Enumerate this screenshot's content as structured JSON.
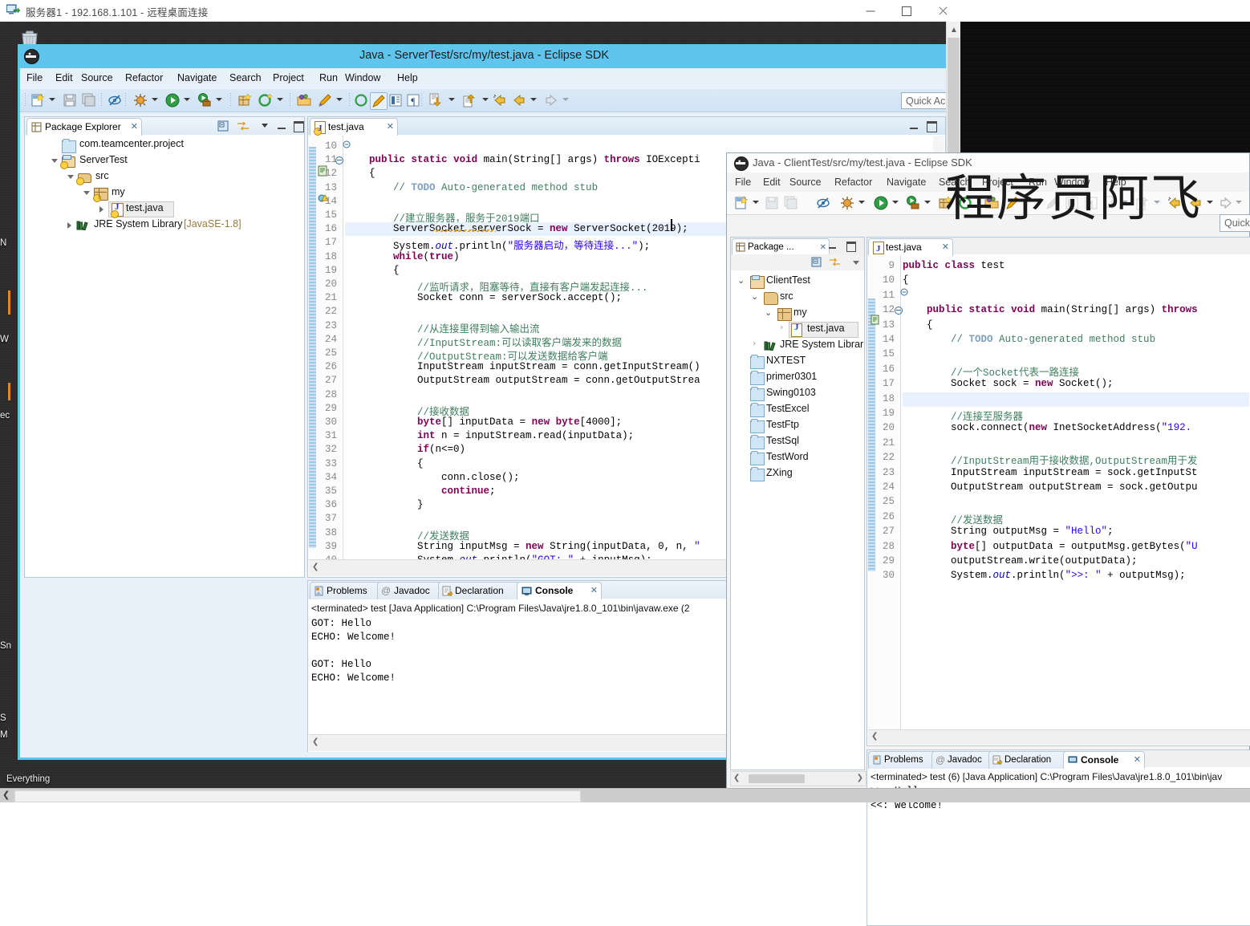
{
  "rdp": {
    "title": "服务器1 - 192.168.1.101 - 远程桌面连接",
    "icon": "remote-desktop-icon",
    "minimize": "—",
    "maximize": "□",
    "close": "✕"
  },
  "desktop": {
    "recycle_bin": "recycle-bin-icon",
    "everything_label": "Everything",
    "partial_icons": [
      "N",
      "W",
      "ec",
      "Sn",
      "S",
      "M"
    ]
  },
  "watermark": "程序员阿飞",
  "window1": {
    "title": "Java - ServerTest/src/my/test.java - Eclipse SDK",
    "menu": [
      "File",
      "Edit",
      "Source",
      "Refactor",
      "Navigate",
      "Search",
      "Project",
      "Run",
      "Window",
      "Help"
    ],
    "quick_access": "Quick Acc",
    "explorer": {
      "tab": "Package Explorer",
      "close_glyph": "✕",
      "tree": [
        {
          "label": "com.teamcenter.project",
          "icon": "folder-blue-icon",
          "indent": 0,
          "arrow": "none"
        },
        {
          "label": "ServerTest",
          "icon": "java-project-icon",
          "indent": 0,
          "arrow": "down"
        },
        {
          "label": "src",
          "icon": "source-folder-icon",
          "indent": 1,
          "arrow": "down"
        },
        {
          "label": "my",
          "icon": "package-icon",
          "indent": 2,
          "arrow": "down"
        },
        {
          "label": "test.java",
          "icon": "java-file-icon",
          "indent": 3,
          "arrow": "right",
          "selected": true
        },
        {
          "label": "JRE System Library",
          "suffix": "[JavaSE-1.8]",
          "icon": "jre-library-icon",
          "indent": 1,
          "arrow": "right"
        }
      ]
    },
    "editor": {
      "tab": "test.java",
      "close_glyph": "✕",
      "first_line": 10,
      "lines": [
        {
          "n": 10,
          "text": ""
        },
        {
          "n": 11,
          "text": "    public static void main(String[] args) throws IOExcepti",
          "fold": true
        },
        {
          "n": 12,
          "text": "    {"
        },
        {
          "n": 13,
          "text": "        // TODO Auto-generated method stub"
        },
        {
          "n": 14,
          "text": ""
        },
        {
          "n": 15,
          "text": "        //建立服务器，服务于2019端口"
        },
        {
          "n": 16,
          "text": "        ServerSocket serverSock = new ServerSocket(2019);",
          "highlight": true
        },
        {
          "n": 17,
          "text": "        System.out.println(\"服务器启动，等待连接...\");"
        },
        {
          "n": 18,
          "text": "        while(true)"
        },
        {
          "n": 19,
          "text": "        {"
        },
        {
          "n": 20,
          "text": "            //监听请求，阻塞等待，直接有客户端发起连接..."
        },
        {
          "n": 21,
          "text": "            Socket conn = serverSock.accept();"
        },
        {
          "n": 22,
          "text": ""
        },
        {
          "n": 23,
          "text": "            //从连接里得到输入输出流"
        },
        {
          "n": 24,
          "text": "            //InputStream:可以读取客户端发来的数据"
        },
        {
          "n": 25,
          "text": "            //OutputStream:可以发送数据给客户端"
        },
        {
          "n": 26,
          "text": "            InputStream inputStream = conn.getInputStream()"
        },
        {
          "n": 27,
          "text": "            OutputStream outputStream = conn.getOutputStrea"
        },
        {
          "n": 28,
          "text": ""
        },
        {
          "n": 29,
          "text": "            //接收数据"
        },
        {
          "n": 30,
          "text": "            byte[] inputData = new byte[4000];"
        },
        {
          "n": 31,
          "text": "            int n = inputStream.read(inputData);"
        },
        {
          "n": 32,
          "text": "            if(n<=0)"
        },
        {
          "n": 33,
          "text": "            {"
        },
        {
          "n": 34,
          "text": "                conn.close();"
        },
        {
          "n": 35,
          "text": "                continue;"
        },
        {
          "n": 36,
          "text": "            }"
        },
        {
          "n": 37,
          "text": ""
        },
        {
          "n": 38,
          "text": "            //发送数据"
        },
        {
          "n": 39,
          "text": "            String inputMsg = new String(inputData, 0, n, \""
        },
        {
          "n": 40,
          "text": "            System.out.println(\"GOT: \" + inputMsg);"
        }
      ]
    },
    "bottom_panel": {
      "tabs": [
        "Problems",
        "Javadoc",
        "Declaration",
        "Console"
      ],
      "active_tab": "Console",
      "close_glyph": "✕",
      "launch_line": "<terminated> test [Java Application] C:\\Program Files\\Java\\jre1.8.0_101\\bin\\javaw.exe (2",
      "output": [
        "GOT: Hello",
        "ECHO: Welcome!",
        "",
        "GOT: Hello",
        "ECHO: Welcome!"
      ]
    }
  },
  "window2": {
    "title": "Java - ClientTest/src/my/test.java - Eclipse SDK",
    "menu": [
      "File",
      "Edit",
      "Source",
      "Refactor",
      "Navigate",
      "Search",
      "Project",
      "Run",
      "Window",
      "Help"
    ],
    "quick_access": "Quick",
    "explorer": {
      "tab": "Package ...",
      "close_glyph": "✕",
      "tree": [
        {
          "label": "ClientTest",
          "icon": "java-project-icon",
          "indent": 0,
          "arrow": "down"
        },
        {
          "label": "src",
          "icon": "source-folder-icon",
          "indent": 1,
          "arrow": "down"
        },
        {
          "label": "my",
          "icon": "package-icon",
          "indent": 2,
          "arrow": "down"
        },
        {
          "label": "test.java",
          "icon": "java-file-icon",
          "indent": 3,
          "arrow": "right",
          "selected": true
        },
        {
          "label": "JRE System Librar",
          "icon": "jre-library-icon",
          "indent": 1,
          "arrow": "right"
        },
        {
          "label": "NXTEST",
          "icon": "folder-blue-icon",
          "indent": 0,
          "arrow": "none"
        },
        {
          "label": "primer0301",
          "icon": "folder-blue-icon",
          "indent": 0,
          "arrow": "none"
        },
        {
          "label": "Swing0103",
          "icon": "folder-blue-icon",
          "indent": 0,
          "arrow": "none"
        },
        {
          "label": "TestExcel",
          "icon": "folder-blue-icon",
          "indent": 0,
          "arrow": "none"
        },
        {
          "label": "TestFtp",
          "icon": "folder-blue-icon",
          "indent": 0,
          "arrow": "none"
        },
        {
          "label": "TestSql",
          "icon": "folder-blue-icon",
          "indent": 0,
          "arrow": "none"
        },
        {
          "label": "TestWord",
          "icon": "folder-blue-icon",
          "indent": 0,
          "arrow": "none"
        },
        {
          "label": "ZXing",
          "icon": "folder-blue-icon",
          "indent": 0,
          "arrow": "none"
        }
      ]
    },
    "editor": {
      "tab": "test.java",
      "close_glyph": "✕",
      "lines": [
        {
          "n": 9,
          "text": "public class test"
        },
        {
          "n": 10,
          "text": "{"
        },
        {
          "n": 11,
          "text": ""
        },
        {
          "n": 12,
          "text": "    public static void main(String[] args) throws",
          "fold": true
        },
        {
          "n": 13,
          "text": "    {"
        },
        {
          "n": 14,
          "text": "        // TODO Auto-generated method stub"
        },
        {
          "n": 15,
          "text": ""
        },
        {
          "n": 16,
          "text": "        //一个Socket代表一路连接"
        },
        {
          "n": 17,
          "text": "        Socket sock = new Socket();"
        },
        {
          "n": 18,
          "text": "",
          "highlight": true
        },
        {
          "n": 19,
          "text": "        //连接至服务器"
        },
        {
          "n": 20,
          "text": "        sock.connect(new InetSocketAddress(\"192."
        },
        {
          "n": 21,
          "text": ""
        },
        {
          "n": 22,
          "text": "        //InputStream用于接收数据,OutputStream用于发"
        },
        {
          "n": 23,
          "text": "        InputStream inputStream = sock.getInputSt"
        },
        {
          "n": 24,
          "text": "        OutputStream outputStream = sock.getOutpu"
        },
        {
          "n": 25,
          "text": ""
        },
        {
          "n": 26,
          "text": "        //发送数据"
        },
        {
          "n": 27,
          "text": "        String outputMsg = \"Hello\";"
        },
        {
          "n": 28,
          "text": "        byte[] outputData = outputMsg.getBytes(\"U"
        },
        {
          "n": 29,
          "text": "        outputStream.write(outputData);"
        },
        {
          "n": 30,
          "text": "        System.out.println(\">>: \" + outputMsg);"
        }
      ]
    },
    "bottom_panel": {
      "tabs": [
        "Problems",
        "Javadoc",
        "Declaration",
        "Console"
      ],
      "active_tab": "Console",
      "close_glyph": "✕",
      "launch_line": "<terminated> test (6) [Java Application] C:\\Program Files\\Java\\jre1.8.0_101\\bin\\jav",
      "output": [
        ">>: Hello",
        "<<: Welcome!"
      ]
    }
  },
  "colors": {
    "eclipse_title_bar": "#5fc5ec",
    "toolbar": "#d6e6f4",
    "highlight_line": "#e8f2fe",
    "keyword": "#7f0055",
    "string": "#2a00ff",
    "comment": "#3f7f5f",
    "taskbar": "#2b2b2b"
  }
}
